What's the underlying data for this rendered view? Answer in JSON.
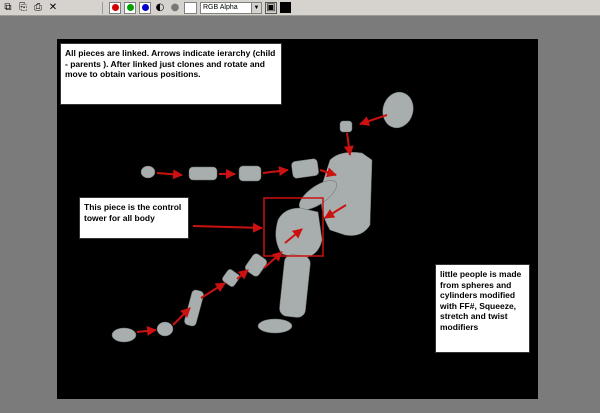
{
  "toolbar": {
    "icons": [
      "copy-channel-icon",
      "paste-icon",
      "print-icon",
      "close-x-icon"
    ],
    "channel_colors": {
      "red": "#d40000",
      "green": "#00a000",
      "blue": "#0000d0"
    },
    "channel_select": "RGB Alpha"
  },
  "notes": {
    "hierarchy": "All pieces are linked. Arrows indicate ierarchy (child - parents ). After linked just clones and rotate and move to obtain various positions.",
    "control_tower": "This piece is the control tower for all body",
    "materials": "little people is made from spheres and cylinders modified with FF#, Squeeze, stretch and twist modifiers"
  },
  "colors": {
    "arrow": "#cc1111",
    "figure": "#a8aeae",
    "viewport": "#000000",
    "frame": "#7b7b7b"
  }
}
